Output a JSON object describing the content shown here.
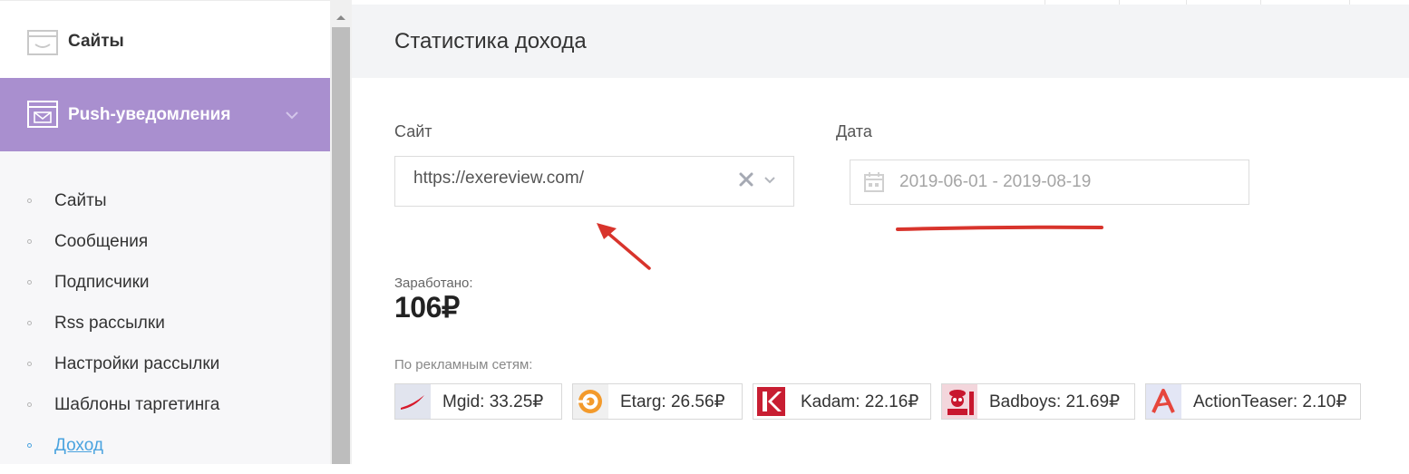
{
  "sidebar": {
    "top_item": {
      "label": "Сайты",
      "icon": "sites-icon"
    },
    "section": {
      "label": "Push-уведомления",
      "icon": "envelope-icon",
      "expanded": true
    },
    "submenu": [
      {
        "label": "Сайты"
      },
      {
        "label": "Сообщения"
      },
      {
        "label": "Подписчики"
      },
      {
        "label": "Rss рассылки"
      },
      {
        "label": "Настройки рассылки"
      },
      {
        "label": "Шаблоны таргетинга"
      },
      {
        "label": "Доход",
        "active": true
      }
    ],
    "accent_color": "#a98fcf"
  },
  "main": {
    "title": "Статистика дохода",
    "site_filter": {
      "label": "Сайт",
      "value": "https://exereview.com/"
    },
    "date_filter": {
      "label": "Дата",
      "value": "2019-06-01 - 2019-08-19"
    },
    "earned": {
      "label": "Заработано:",
      "value": "106₽"
    },
    "networks": {
      "label": "По рекламным сетям:",
      "items": [
        {
          "text": "Mgid: 33.25₽"
        },
        {
          "text": "Etarg: 26.56₽"
        },
        {
          "text": "Kadam: 22.16₽"
        },
        {
          "text": "Badboys: 21.69₽"
        },
        {
          "text": "ActionTeaser: 2.10₽"
        }
      ]
    }
  },
  "colors": {
    "annotation": "#d8342c",
    "link": "#4aa3df"
  }
}
